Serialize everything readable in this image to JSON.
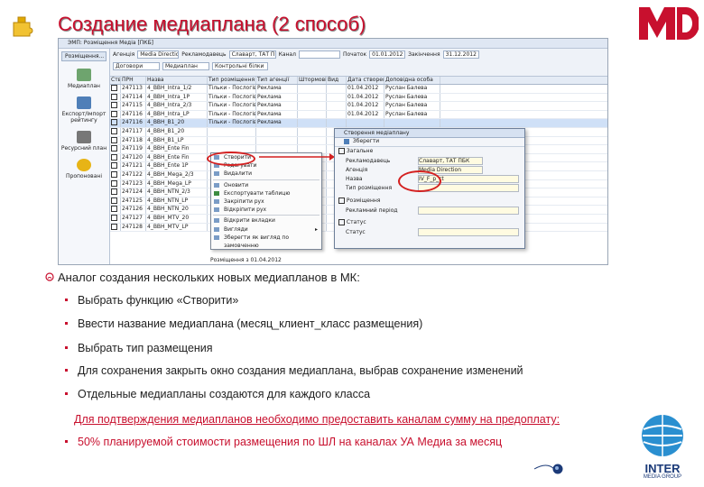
{
  "slide": {
    "title": "Создание медиаплана (2 способ)",
    "brand_color": "#c8102e"
  },
  "app": {
    "window_title": "ЭМП: Розміщення Медіа [ПКБ]",
    "left_button": "Розміщення...",
    "nav": [
      "Медиаплан",
      "Експорт/Імпорт рейтингу",
      "Ресурсний план",
      "Пропоновані"
    ],
    "filter_row1": [
      "Агенція",
      "Media Direction",
      "Рекламодавець",
      "Славарт, ТАТ ПБК",
      "Канал",
      "Початок",
      "01.01.2012",
      "Закінчення",
      "31.12.2012"
    ],
    "filter_row2": [
      "Договори",
      "Медиаплан",
      "Контрольні білки"
    ],
    "tabs": [
      "Медиаплани",
      "Контрольні облики"
    ],
    "columns": [
      "Ств",
      "ПРН",
      "Назва",
      "Тип розміщення",
      "Тип агенції",
      "Штормові",
      "Вид",
      "Дата створення",
      "Доповідна особа"
    ],
    "rows": [
      {
        "id": "247113",
        "name": "4_BBH_Intra_1/2",
        "type": "Тільки - Послогівна",
        "agency": "Реклама",
        "date": "01.04.2012",
        "person": "Руслан Балева"
      },
      {
        "id": "247114",
        "name": "4_BBH_Intra_1P",
        "type": "Тільки - Послогівна",
        "agency": "Реклама",
        "date": "01.04.2012",
        "person": "Руслан Балева"
      },
      {
        "id": "247115",
        "name": "4_BBH_Intra_2/3",
        "type": "Тільки - Послогівна",
        "agency": "Реклама",
        "date": "01.04.2012",
        "person": "Руслан Балева"
      },
      {
        "id": "247116",
        "name": "4_BBH_Intra_LP",
        "type": "Тільки - Послогівна",
        "agency": "Реклама",
        "date": "01.04.2012",
        "person": "Руслан Балева"
      },
      {
        "id": "247116",
        "name": "4_BBH_B1_20",
        "type": "Тільки - Послогівна",
        "agency": "Реклама",
        "date": "",
        "person": ""
      },
      {
        "id": "247117",
        "name": "4_BBH_B1_20",
        "type": "",
        "agency": "",
        "date": "",
        "person": ""
      },
      {
        "id": "247118",
        "name": "4_BBH_B1_LP",
        "type": "",
        "agency": "",
        "date": "",
        "person": ""
      },
      {
        "id": "247119",
        "name": "4_BBH_Ente Fin",
        "type": "",
        "agency": "",
        "date": "",
        "person": ""
      },
      {
        "id": "247120",
        "name": "4_BBH_Ente Fin",
        "type": "",
        "agency": "",
        "date": "",
        "person": ""
      },
      {
        "id": "247121",
        "name": "4_BBH_Ente 1P",
        "type": "",
        "agency": "",
        "date": "",
        "person": ""
      },
      {
        "id": "247122",
        "name": "4_BBH_Mega_2/3",
        "type": "",
        "agency": "",
        "date": "",
        "person": ""
      },
      {
        "id": "247123",
        "name": "4_BBH_Mega_LP",
        "type": "",
        "agency": "",
        "date": "",
        "person": ""
      },
      {
        "id": "247124",
        "name": "4_BBH_NTN_2/3",
        "type": "",
        "agency": "",
        "date": "",
        "person": ""
      },
      {
        "id": "247125",
        "name": "4_BBH_NTN_LP",
        "type": "",
        "agency": "",
        "date": "",
        "person": ""
      },
      {
        "id": "247126",
        "name": "4_BBH_NTN_20",
        "type": "",
        "agency": "",
        "date": "",
        "person": ""
      },
      {
        "id": "247127",
        "name": "4_BBH_MTV_20",
        "type": "",
        "agency": "",
        "date": "",
        "person": ""
      },
      {
        "id": "247128",
        "name": "4_BBH_MTV_LP",
        "type": "",
        "agency": "",
        "date": "",
        "person": ""
      }
    ],
    "context_menu": [
      "Створити",
      "Редагувати",
      "Видалити",
      "Оновити",
      "Експортувати таблицю",
      "Закріпити рух",
      "Відкріпити рух",
      "Відкрити вкладки",
      "Вигляди",
      "Зберегти як вигляд по замовченню"
    ],
    "dialog": {
      "title": "Створення медіаплану",
      "save": "Зберегти",
      "sections": [
        "Загальне",
        "Розміщення",
        "Статус"
      ],
      "labels": [
        "Рекламодавець",
        "Агенція",
        "Назва",
        "Тип розміщення",
        "Рекламний період",
        "Статус"
      ],
      "values": [
        "Славарт, ТАТ ПБК",
        "Media Direction",
        "IV_F_p_ct"
      ]
    },
    "status": "Розміщення з 01.04.2012"
  },
  "bullets": {
    "main": "Аналог создания нескольких новых медиапланов в МК:",
    "items": [
      "Выбрать функцию «Створити»",
      "Ввести название медиаплана (месяц_клиент_класс размещения)",
      "Выбрать тип размещения",
      "Для сохранения закрыть окно создания медиаплана, выбрав сохранение изменений",
      "Отдельные медиапланы создаются для каждого класса"
    ],
    "note": "Для подтверждения медиапланов необходимо предоставить каналам сумму на предоплату:",
    "sub": "50% планируемой стоимости размещения по ШЛ на каналах УА Медиа за месяц"
  },
  "logos": {
    "md": "MD",
    "inter": "INTER",
    "inter_sub": "MEDIA GROUP"
  }
}
